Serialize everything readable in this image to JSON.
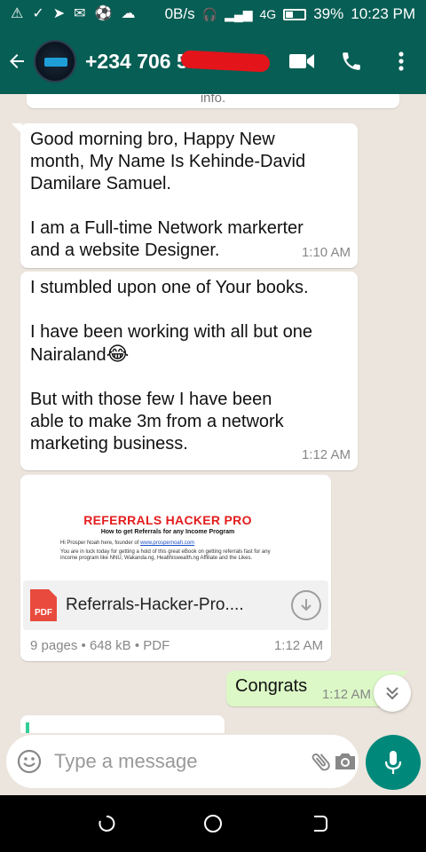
{
  "status_bar": {
    "speed": "0B/s",
    "network": "4G",
    "battery_percent": "39%",
    "battery_level": 0.39,
    "time": "10:23 PM",
    "left_icons": [
      "alert-triangle-icon",
      "check-icon",
      "telegram-icon",
      "gmail-icon",
      "soccer-ball-icon",
      "cloud-icon"
    ]
  },
  "header": {
    "contact_name": "+234 706 5",
    "icons": [
      "back-arrow-icon",
      "video-call-icon",
      "phone-icon",
      "more-vert-icon"
    ]
  },
  "messages": {
    "prev_fragment": "info.",
    "m1": {
      "lines": [
        "Good morning bro, Happy New",
        "month, My Name Is Kehinde-David",
        "Damilare Samuel.",
        "",
        "I am a Full-time Network markerter",
        "and a website Designer."
      ],
      "time": "1:10 AM"
    },
    "m2": {
      "line1": "I stumbled upon one of Your books.",
      "line2": "I have been working with all but one",
      "line3": "Nairaland",
      "emoji": "😂",
      "line4": "But with those few I have been",
      "line5": "able to make 3m from a network",
      "line6": "marketing business.",
      "time": "1:12 AM"
    },
    "doc": {
      "preview_title": "REFERRALS HACKER PRO",
      "preview_subtitle": "How to get Referrals for any Income Program",
      "preview_line1_a": "Hi Prosper Noah here, founder of ",
      "preview_line1_link": "www.prospernoah.com",
      "preview_line2": "You are in luck today for getting a hold of this great eBook on getting referrals fast for any",
      "preview_line3": "income program like NNU, Wakanda.ng, Healthiswealth.ng Affiliate and the Likes.",
      "pdf_label": "PDF",
      "filename": "Referrals-Hacker-Pro....",
      "meta": "9 pages • 648 kB • PDF",
      "time": "1:12 AM"
    },
    "outgoing": {
      "text": "Congrats",
      "time": "1:12 AM"
    }
  },
  "input": {
    "placeholder": "Type a message"
  },
  "colors": {
    "header": "#075E54",
    "chat_bg": "#ECE5DD",
    "outgoing": "#DCF8C6",
    "mic": "#00897B",
    "redaction": "#e4141b"
  }
}
